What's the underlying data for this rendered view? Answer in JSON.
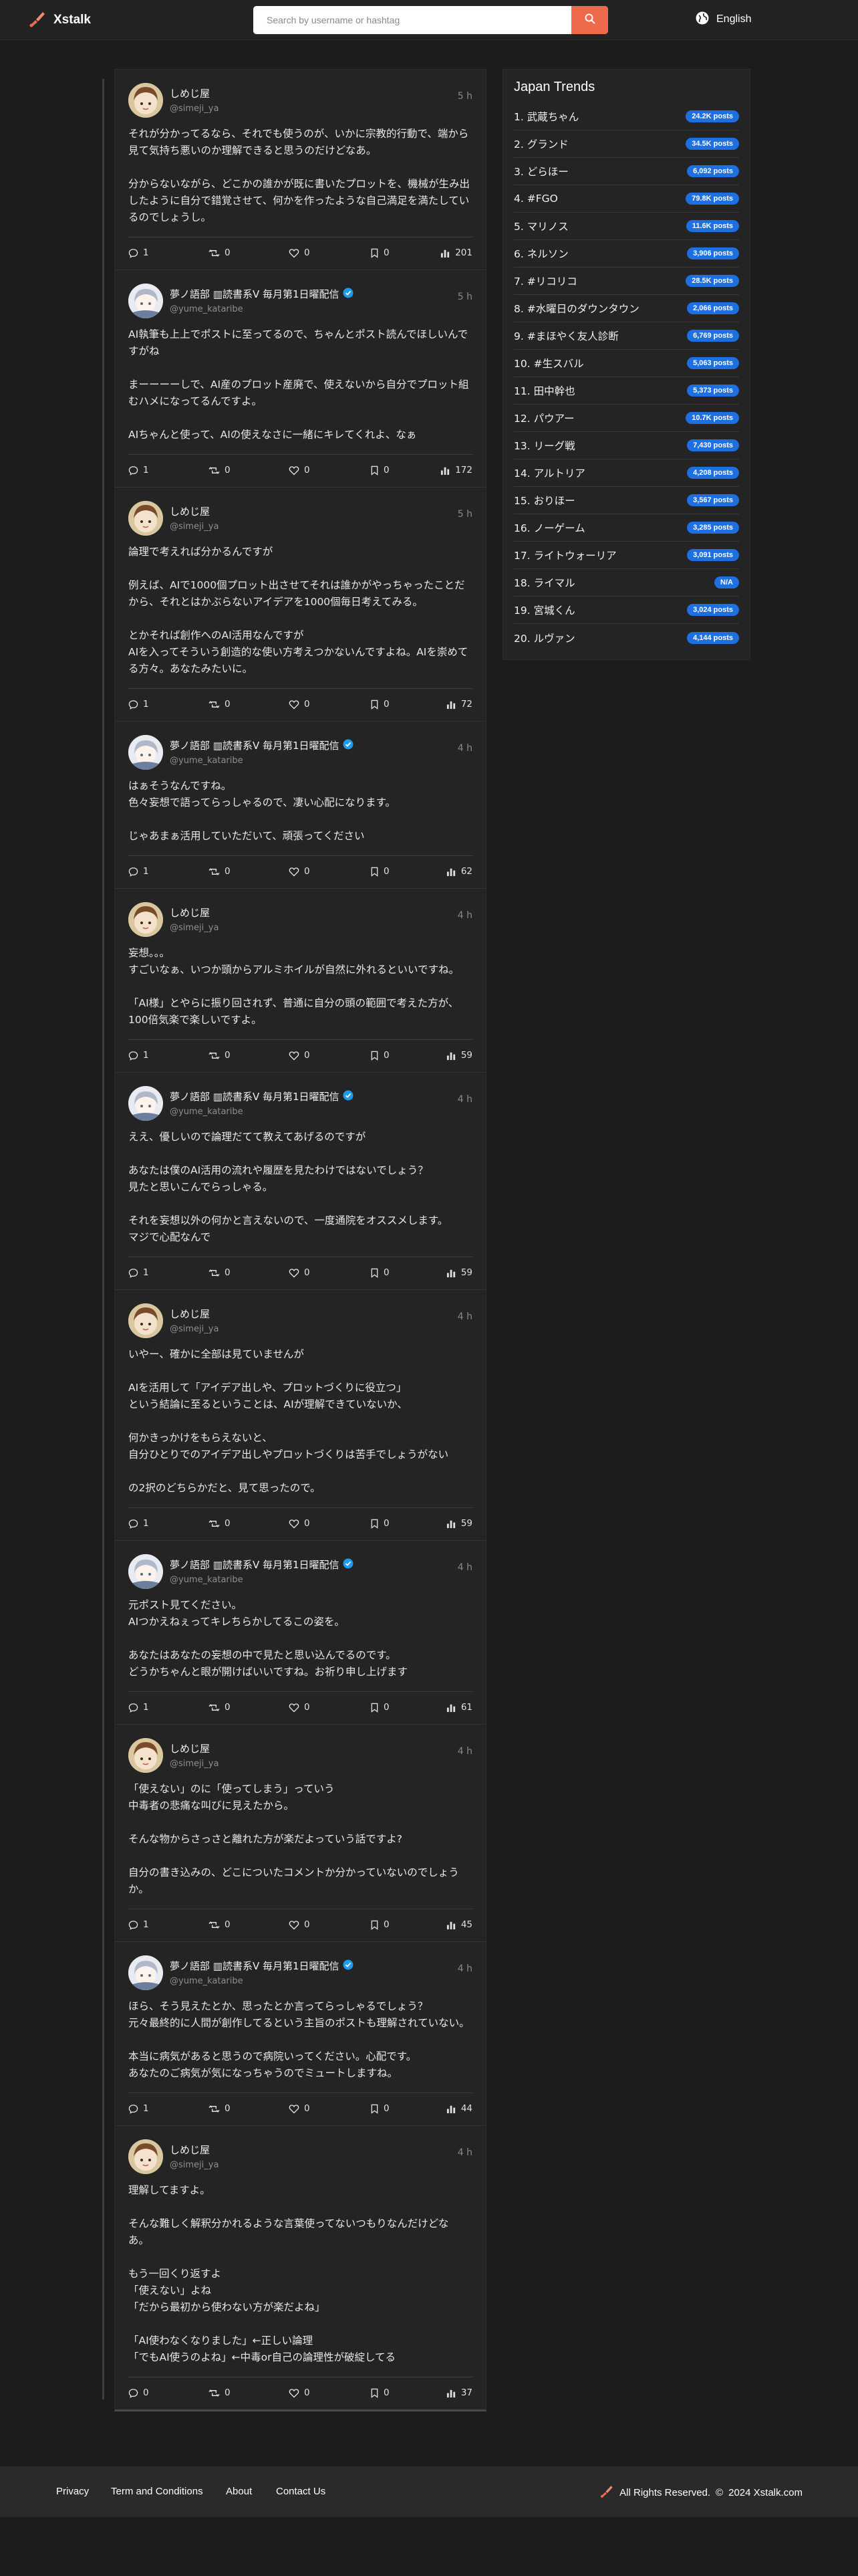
{
  "header": {
    "brand": "Xstalk",
    "search_placeholder": "Search by username or hashtag",
    "language": "English"
  },
  "posts": [
    {
      "name": "しめじ屋",
      "handle": "@simeji_ya",
      "avatar": "simeji",
      "verified": false,
      "time": "5 h",
      "text": "それが分かってるなら、それでも使うのが、いかに宗教的行動で、端から見て気持ち悪いのか理解できると思うのだけどなあ。\n\n分からないながら、どこかの誰かが既に書いたプロットを、機械が生み出したように自分で錯覚させて、何かを作ったような自己満足を満たしているのでしょうし。",
      "replies": "1",
      "reposts": "0",
      "likes": "0",
      "bookmarks": "0",
      "views": "201"
    },
    {
      "name": "夢ノ語部 ▥読書系V 毎月第1日曜配信",
      "handle": "@yume_kataribe",
      "avatar": "yume",
      "verified": true,
      "time": "5 h",
      "text": "AI執筆も上上でポストに至ってるので、ちゃんとポスト読んでほしいんですがね\n\nまーーーーしで、AI産のプロット産廃で、使えないから自分でプロット組むハメになってるんですよ。\n\nAIちゃんと使って、AIの使えなさに一緒にキレてくれよ、なぁ",
      "replies": "1",
      "reposts": "0",
      "likes": "0",
      "bookmarks": "0",
      "views": "172"
    },
    {
      "name": "しめじ屋",
      "handle": "@simeji_ya",
      "avatar": "simeji",
      "verified": false,
      "time": "5 h",
      "text": "論理で考えれば分かるんですが\n\n例えば、AIで1000個プロット出させてそれは誰かがやっちゃったことだから、それとはかぶらないアイデアを1000個毎日考えてみる。\n\nとかそれば創作へのAI活用なんですが\nAIを入ってそういう創造的な使い方考えつかないんですよね。AIを崇めてる方々。あなたみたいに。",
      "replies": "1",
      "reposts": "0",
      "likes": "0",
      "bookmarks": "0",
      "views": "72"
    },
    {
      "name": "夢ノ語部 ▥読書系V 毎月第1日曜配信",
      "handle": "@yume_kataribe",
      "avatar": "yume",
      "verified": true,
      "time": "4 h",
      "text": "はぁそうなんですね。\n色々妄想で語ってらっしゃるので、凄い心配になります。\n\nじゃあまぁ活用していただいて、頑張ってください",
      "replies": "1",
      "reposts": "0",
      "likes": "0",
      "bookmarks": "0",
      "views": "62"
    },
    {
      "name": "しめじ屋",
      "handle": "@simeji_ya",
      "avatar": "simeji",
      "verified": false,
      "time": "4 h",
      "text": "妄想。。。\nすごいなぁ、いつか頭からアルミホイルが自然に外れるといいですね。\n\n「AI様」とやらに振り回されず、普通に自分の頭の範囲で考えた方が、100倍気楽で楽しいですよ。",
      "replies": "1",
      "reposts": "0",
      "likes": "0",
      "bookmarks": "0",
      "views": "59"
    },
    {
      "name": "夢ノ語部 ▥読書系V 毎月第1日曜配信",
      "handle": "@yume_kataribe",
      "avatar": "yume",
      "verified": true,
      "time": "4 h",
      "text": "ええ、優しいので論理だてて教えてあげるのですが\n\nあなたは僕のAI活用の流れや履歴を見たわけではないでしょう？\n見たと思いこんでらっしゃる。\n\nそれを妄想以外の何かと言えないので、一度通院をオススメします。\nマジで心配なんで",
      "replies": "1",
      "reposts": "0",
      "likes": "0",
      "bookmarks": "0",
      "views": "59"
    },
    {
      "name": "しめじ屋",
      "handle": "@simeji_ya",
      "avatar": "simeji",
      "verified": false,
      "time": "4 h",
      "text": "いやー、確かに全部は見ていませんが\n\nAIを活用して「アイデア出しや、プロットづくりに役立つ」\nという結論に至るということは、AIが理解できていないか、\n\n何かきっかけをもらえないと、\n自分ひとりでのアイデア出しやプロットづくりは苦手でしょうがない\n\nの2択のどちらかだと、見て思ったので。",
      "replies": "1",
      "reposts": "0",
      "likes": "0",
      "bookmarks": "0",
      "views": "59"
    },
    {
      "name": "夢ノ語部 ▥読書系V 毎月第1日曜配信",
      "handle": "@yume_kataribe",
      "avatar": "yume",
      "verified": true,
      "time": "4 h",
      "text": "元ポスト見てください。\nAIつかえねぇってキレちらかしてるこの姿を。\n\nあなたはあなたの妄想の中で見たと思い込んでるのです。\nどうかちゃんと眼が開けばいいですね。お祈り申し上げます",
      "replies": "1",
      "reposts": "0",
      "likes": "0",
      "bookmarks": "0",
      "views": "61"
    },
    {
      "name": "しめじ屋",
      "handle": "@simeji_ya",
      "avatar": "simeji",
      "verified": false,
      "time": "4 h",
      "text": "「使えない」のに「使ってしまう」っていう\n中毒者の悲痛な叫びに見えたから。\n\nそんな物からさっさと離れた方が楽だよっていう話ですよ?\n\n自分の書き込みの、どこについたコメントか分かっていないのでしょうか。",
      "replies": "1",
      "reposts": "0",
      "likes": "0",
      "bookmarks": "0",
      "views": "45"
    },
    {
      "name": "夢ノ語部 ▥読書系V 毎月第1日曜配信",
      "handle": "@yume_kataribe",
      "avatar": "yume",
      "verified": true,
      "time": "4 h",
      "text": "ほら、そう見えたとか、思ったとか言ってらっしゃるでしょう？\n元々最終的に人間が創作してるという主旨のポストも理解されていない。\n\n本当に病気があると思うので病院いってください。心配です。\nあなたのご病気が気になっちゃうのでミュートしますね。",
      "replies": "1",
      "reposts": "0",
      "likes": "0",
      "bookmarks": "0",
      "views": "44"
    },
    {
      "name": "しめじ屋",
      "handle": "@simeji_ya",
      "avatar": "simeji",
      "verified": false,
      "time": "4 h",
      "text": "理解してますよ。\n\nそんな難しく解釈分かれるような言葉使ってないつもりなんだけどな\nあ。\n\nもう一回くり返すよ\n「使えない」よね\n「だから最初から使わない方が楽だよね」\n\n「AI使わなくなりました」←正しい論理\n「でもAI使うのよね」←中毒or自己の論理性が破綻してる",
      "replies": "0",
      "reposts": "0",
      "likes": "0",
      "bookmarks": "0",
      "views": "37"
    }
  ],
  "trends": {
    "title": "Japan Trends",
    "items": [
      {
        "name": "1. 武蔵ちゃん",
        "count": "24.2K posts"
      },
      {
        "name": "2. グランド",
        "count": "34.5K posts"
      },
      {
        "name": "3. どらほー",
        "count": "6,092 posts"
      },
      {
        "name": "4. #FGO",
        "count": "79.8K posts"
      },
      {
        "name": "5. マリノス",
        "count": "11.6K posts"
      },
      {
        "name": "6. ネルソン",
        "count": "3,906 posts"
      },
      {
        "name": "7. #リコリコ",
        "count": "28.5K posts"
      },
      {
        "name": "8. #水曜日のダウンタウン",
        "count": "2,066 posts"
      },
      {
        "name": "9. #まほやく友人診断",
        "count": "6,769 posts"
      },
      {
        "name": "10. #生スバル",
        "count": "5,063 posts"
      },
      {
        "name": "11. 田中幹也",
        "count": "5,373 posts"
      },
      {
        "name": "12. パウアー",
        "count": "10.7K posts"
      },
      {
        "name": "13. リーグ戦",
        "count": "7,430 posts"
      },
      {
        "name": "14. アルトリア",
        "count": "4,208 posts"
      },
      {
        "name": "15. おりほー",
        "count": "3,567 posts"
      },
      {
        "name": "16. ノーゲーム",
        "count": "3,285 posts"
      },
      {
        "name": "17. ライトウォーリア",
        "count": "3,091 posts"
      },
      {
        "name": "18. ライマル",
        "count": "N/A"
      },
      {
        "name": "19. 宮城くん",
        "count": "3,024 posts"
      },
      {
        "name": "20. ルヴァン",
        "count": "4,144 posts"
      }
    ]
  },
  "footer": {
    "links": [
      "Privacy",
      "Term and Conditions",
      "About",
      "Contact Us"
    ],
    "rights": "All Rights Reserved.",
    "copyright": "2024 Xstalk.com"
  },
  "colors": {
    "accent": "#ef6a4a",
    "badge": "#1e6fe0",
    "verified": "#1d9bf0",
    "background": "#1c1c1c"
  }
}
